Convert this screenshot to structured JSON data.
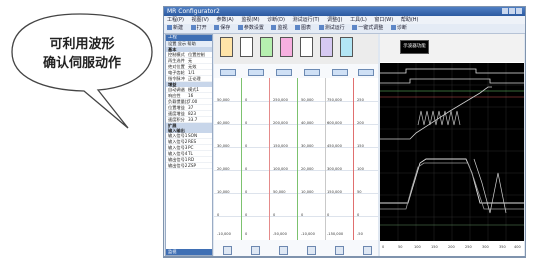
{
  "callout": {
    "line1": "可利用波形",
    "line2": "确认伺服动作"
  },
  "window": {
    "title": "MR Configurator2"
  },
  "menu": [
    "工程(P)",
    "视图(V)",
    "参数(A)",
    "监视(M)",
    "诊断(D)",
    "测试运行(T)",
    "调整(J)",
    "工具(L)",
    "窗口(W)",
    "帮助(H)"
  ],
  "toolbar": [
    "新建",
    "打开",
    "保存",
    "参数设置",
    "监视",
    "图表",
    "测试运行",
    "一键式调整",
    "诊断"
  ],
  "sidebar": {
    "header": "工程",
    "tabs": "设置  显示  帮助",
    "sections": [
      "基本",
      "增益",
      "扩展",
      "输入输出"
    ],
    "rows": [
      {
        "k": "控制模式",
        "v": "位置控制"
      },
      {
        "k": "再生选件",
        "v": "无"
      },
      {
        "k": "绝对位置",
        "v": "无效"
      },
      {
        "k": "电子齿轮",
        "v": "1/1"
      },
      {
        "k": "指令脉冲",
        "v": "正论理"
      },
      {
        "k": "自动调谐",
        "v": "模式1"
      },
      {
        "k": "响应性",
        "v": "16"
      },
      {
        "k": "负载惯量比",
        "v": "7.00"
      },
      {
        "k": "位置增益",
        "v": "37"
      },
      {
        "k": "速度增益",
        "v": "823"
      },
      {
        "k": "速度积分",
        "v": "33.7"
      },
      {
        "k": "输入信号1",
        "v": "SON"
      },
      {
        "k": "输入信号2",
        "v": "RES"
      },
      {
        "k": "输入信号3",
        "v": "PC"
      },
      {
        "k": "输入信号4",
        "v": "TL"
      },
      {
        "k": "输出信号1",
        "v": "RD"
      },
      {
        "k": "输出信号2",
        "v": "ZSP"
      }
    ],
    "footer": "监视"
  },
  "graph_button": "示波器功能",
  "table": {
    "rows": [
      [
        "50,000",
        "0",
        "250,000",
        "50,000",
        "750,000",
        "250"
      ],
      [
        "40,000",
        "0",
        "200,000",
        "40,000",
        "600,000",
        "200"
      ],
      [
        "30,000",
        "0",
        "150,000",
        "30,000",
        "450,000",
        "150"
      ],
      [
        "20,000",
        "0",
        "100,000",
        "20,000",
        "300,000",
        "100"
      ],
      [
        "10,000",
        "0",
        "50,000",
        "10,000",
        "150,000",
        "50"
      ],
      [
        "0",
        "0",
        "0",
        "0",
        "0",
        "0"
      ],
      [
        "-10,000",
        "0",
        "-50,000",
        "-10,000",
        "-150,000",
        "-50"
      ]
    ]
  },
  "axis_labels": [
    "0",
    "50",
    "100",
    "150",
    "200",
    "250",
    "300",
    "350",
    "400"
  ]
}
